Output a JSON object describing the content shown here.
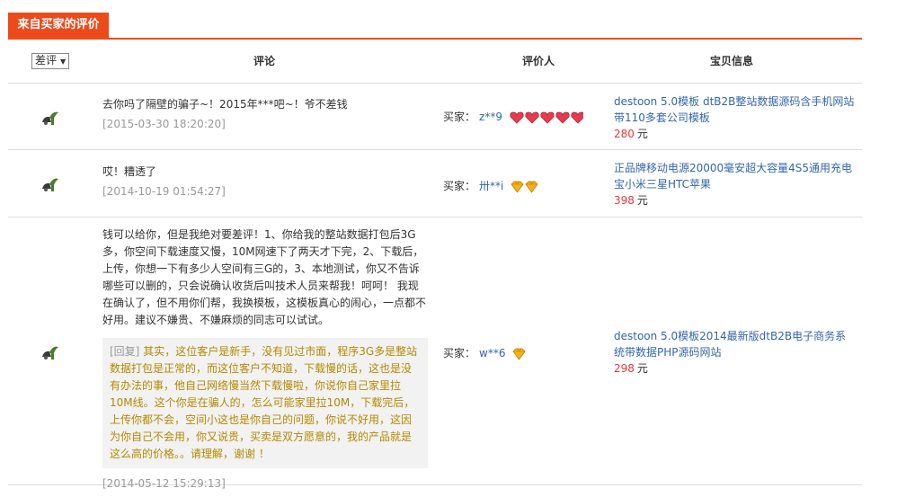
{
  "section_tab": "来自买家的评价",
  "header": {
    "sort_label": "差评",
    "comment_col": "评论",
    "rater_col": "评价人",
    "item_col": "宝贝信息"
  },
  "reviews": [
    {
      "comment": "去你吗了隔壁的骗子~！2015年***吧~！爷不差钱",
      "date": "[2015-03-30 18:20:20]",
      "buyer_label": "买家：",
      "buyer_name": "z**9",
      "rank_icon": "red-heart-icon",
      "rank_count": 5,
      "item_title": "destoon 5.0模板 dtB2B整站数据源码含手机网站带110多套公司模板",
      "price": "280",
      "unit": "元"
    },
    {
      "comment": "哎！糟透了",
      "date": "[2014-10-19 01:54:27]",
      "buyer_label": "买家：",
      "buyer_name": "卅**i",
      "rank_icon": "diamond-icon",
      "rank_count": 2,
      "item_title": "正品牌移动电源20000毫安超大容量4S5通用充电宝小米三星HTC苹果",
      "price": "398",
      "unit": "元"
    },
    {
      "comment": "钱可以给你，但是我绝对要差评！1、你给我的整站数据打包后3G多，你空间下载速度又慢，10M网速下了两天才下完，2、下载后，上传，你想一下有多少人空间有三G的，3、本地测试，你又不告诉哪些可以删的，只会说确认收货后叫技术人员来帮我！呵呵！ 我现在确认了，但不用你们帮，我换模板，这模板真心的闹心，一点都不好用。建议不嫌贵、不嫌麻烦的同志可以试试。",
      "reply_tag": "[回复]",
      "reply": "其实，这位客户是新手，没有见过市面，程序3G多是整站数据打包是正常的，而这位客户不知道，下载慢的话，这也是没有办法的事，他自己网络慢当然下载慢啦，你说你自己家里拉10M线。这个你是在骗人的，怎么可能家里拉10M，下载完后，上传你都不会，空间小这也是你自己的问题，你说不好用，这因为你自己不会用，你又说贵，买卖是双方愿意的，我的产品就是这么高的价格。。请理解，谢谢 ！",
      "date": "[2014-05-12 15:29:13]",
      "buyer_label": "买家：",
      "buyer_name": "w**6",
      "rank_icon": "diamond-icon",
      "rank_count": 1,
      "item_title": "destoon 5.0模板2014最新版dtB2B电子商务系统带数据PHP源码网站",
      "price": "298",
      "unit": "元"
    }
  ],
  "colors": {
    "accent": "#ec4a1a",
    "link": "#3366aa",
    "price": "#e4393c",
    "reply_text": "#b58900",
    "negative_icon": "#4a7a2a"
  }
}
